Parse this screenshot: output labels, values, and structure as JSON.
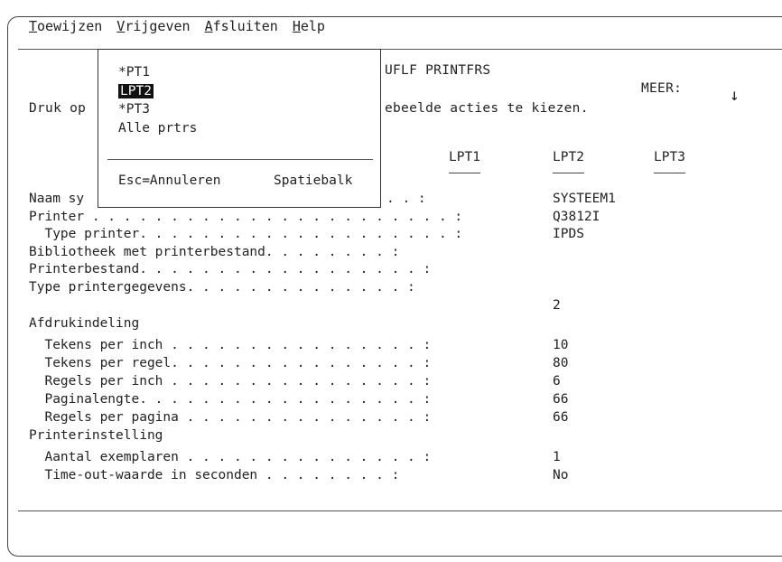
{
  "menu": {
    "items": [
      {
        "first": "T",
        "rest": "oewijzen"
      },
      {
        "first": "V",
        "rest": "rijgeven"
      },
      {
        "first": "A",
        "rest": "fsluiten"
      },
      {
        "first": "H",
        "rest": "elp"
      }
    ]
  },
  "panel_title_fragment": "UFLF PRINTFRS",
  "more_label": "MEER:",
  "more_arrow": "↓",
  "instruction_left": "Druk op",
  "instruction_right": "ebeelde acties te kiezen.",
  "popup": {
    "options": [
      "*PT1",
      "LPT2",
      "*PT3",
      "Alle prtrs"
    ],
    "selected_index": 1,
    "esc_label": "Esc=Annuleren",
    "space_label": "Spatiebalk"
  },
  "columns": [
    "LPT1",
    "LPT2",
    "LPT3"
  ],
  "rows": [
    {
      "label": "Naam sy",
      "dots": ". . :",
      "value": "SYSTEEM1"
    },
    {
      "label": "Printer . . . . . . . . . . . . . . . . . . . . . . . :",
      "value": "Q3812I"
    },
    {
      "label": "  Type printer. . . . . . . . . . . . . . . . . . . . :",
      "value": "IPDS"
    },
    {
      "label": "Bibliotheek met printerbestand. . . . . . . . :",
      "value": ""
    },
    {
      "label": "Printerbestand. . . . . . . . . . . . . . . . . . :",
      "value": ""
    },
    {
      "label": "Type printergegevens. . . . . . . . . . . . . . :",
      "value": "2"
    },
    {
      "label": "Afdrukindeling",
      "value": ""
    },
    {
      "label": "  Tekens per inch . . . . . . . . . . . . . . . . :",
      "value": "10"
    },
    {
      "label": "  Tekens per regel. . . . . . . . . . . . . . . . :",
      "value": "80"
    },
    {
      "label": "  Regels per inch . . . . . . . . . . . . . . . . :",
      "value": "6"
    },
    {
      "label": "  Paginalengte. . . . . . . . . . . . . . . . . . :",
      "value": "66"
    },
    {
      "label": "  Regels per pagina . . . . . . . . . . . . . . . :",
      "value": "66"
    },
    {
      "label": "Printerinstelling",
      "value": ""
    },
    {
      "label": "  Aantal exemplaren . . . . . . . . . . . . . . . :",
      "value": "1"
    },
    {
      "label": "  Time-out-waarde in seconden . . . . . . . . :",
      "value": "No"
    }
  ]
}
